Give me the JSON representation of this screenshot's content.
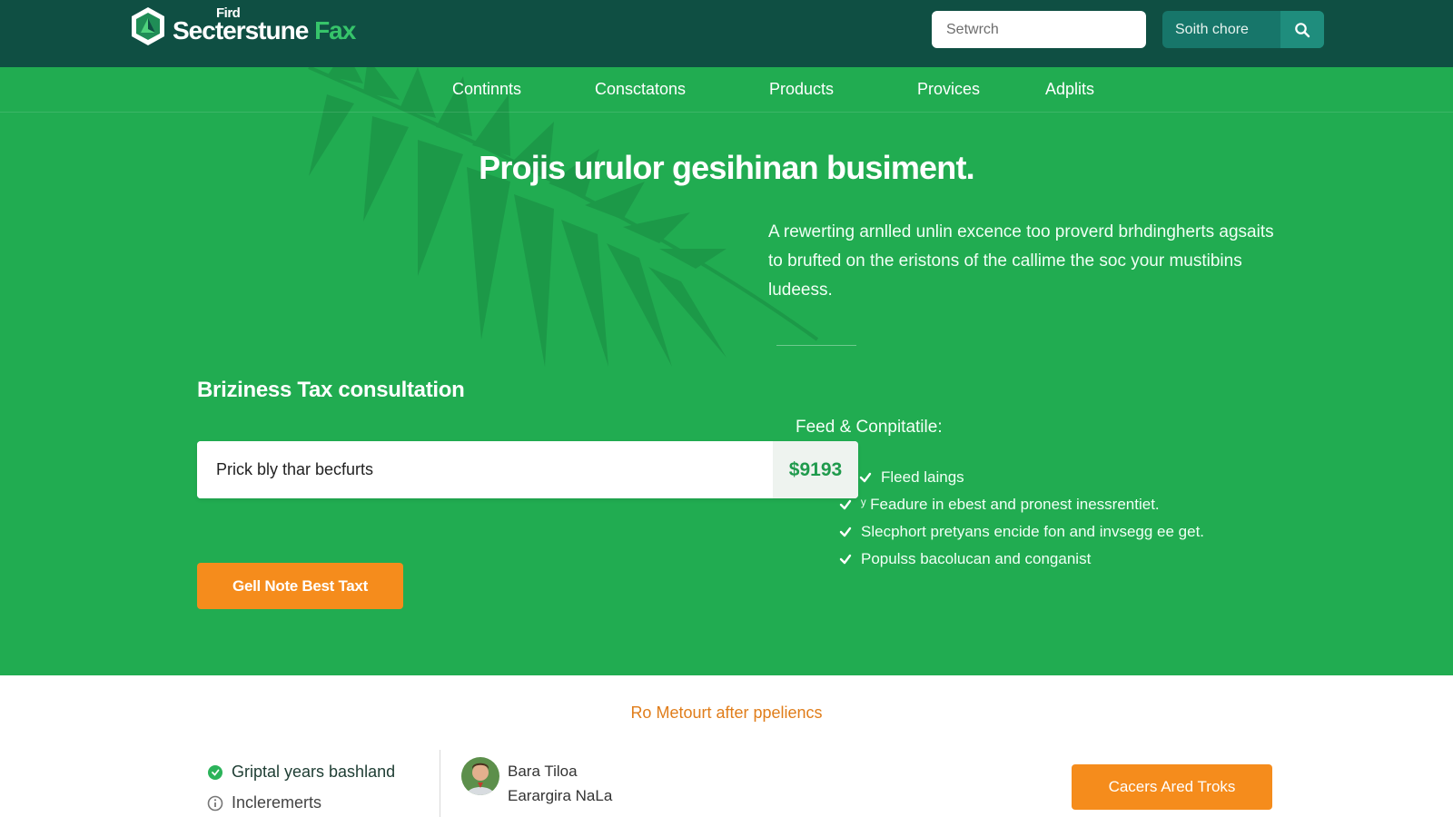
{
  "header": {
    "logo_superscript": "Fird",
    "logo_main": "Secterstune",
    "logo_accent": "Fax",
    "search_placeholder": "Setwrch",
    "search_button_label": "Soith chore"
  },
  "nav": {
    "items": [
      {
        "label": "Continnts"
      },
      {
        "label": "Consctatons"
      },
      {
        "label": "Products"
      },
      {
        "label": "Provices"
      },
      {
        "label": "Adplits"
      }
    ]
  },
  "hero": {
    "title": "Projis urulor gesihinan busiment.",
    "description": "A rewerting arnlled unlin excence too proverd brhdingherts agsaits to brufted on the eristons of the callime the soc your mustibins ludeess."
  },
  "consultation": {
    "title": "Briziness Tax consultation",
    "input_value": "Prick bly thar becfurts",
    "price": "$9193",
    "cta_label": "Gell Note Best Taxt"
  },
  "features": {
    "title": "Feed & Conpitatile:",
    "items": [
      {
        "text": "Fleed laings"
      },
      {
        "text": "ʸ Feadure in ebest and pronest inessrentiet."
      },
      {
        "text": "Slecphort pretyans encide fon and invsegg ee get."
      },
      {
        "text": "Populss bacolucan and conganist"
      }
    ]
  },
  "lower": {
    "title": "Ro Metourt after ppeliencs",
    "stats": [
      {
        "text": "Griptal years bashland",
        "icon": "green-dot-icon"
      },
      {
        "text": "Incleremerts",
        "icon": "info-circle-icon"
      }
    ],
    "person": {
      "name": "Bara Tiloa",
      "role": "Earargira NaLa"
    },
    "cta_label": "Cacers Ared Troks"
  },
  "colors": {
    "header_bg": "#0f4f43",
    "hero_bg": "#21ac51",
    "accent_orange": "#f58c1c",
    "brand_green": "#36c46a"
  }
}
